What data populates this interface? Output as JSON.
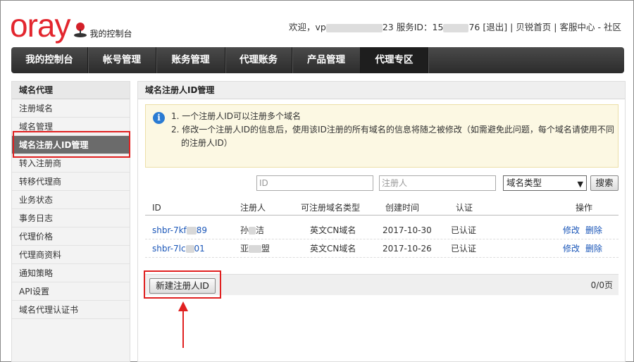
{
  "brand": {
    "logo": "oray",
    "console_label": "我的控制台"
  },
  "topbar": {
    "welcome": "欢迎，vp",
    "user_suffix": "23",
    "service_id_label": "服务ID：15",
    "service_id_suffix": "76",
    "logout": "[退出]",
    "sep1": "|",
    "home_link": "贝锐首页",
    "sep2": "|",
    "support_link": "客服中心",
    "dash": "-",
    "community_link": "社区"
  },
  "nav": {
    "items": [
      {
        "label": "我的控制台"
      },
      {
        "label": "帐号管理"
      },
      {
        "label": "账务管理"
      },
      {
        "label": "代理账务"
      },
      {
        "label": "产品管理"
      },
      {
        "label": "代理专区"
      }
    ],
    "active_index": 5
  },
  "sidebar": {
    "title": "域名代理",
    "items": [
      {
        "label": "注册域名"
      },
      {
        "label": "域名管理"
      },
      {
        "label": "域名注册人ID管理"
      },
      {
        "label": "转入注册商"
      },
      {
        "label": "转移代理商"
      },
      {
        "label": "业务状态"
      },
      {
        "label": "事务日志"
      },
      {
        "label": "代理价格"
      },
      {
        "label": "代理商资料"
      },
      {
        "label": "通知策略"
      },
      {
        "label": "API设置"
      },
      {
        "label": "域名代理认证书"
      }
    ],
    "active_index": 2
  },
  "main": {
    "title": "域名注册人ID管理",
    "notice": {
      "icon": "info-icon",
      "line1": "1. 一个注册人ID可以注册多个域名",
      "line2a": "2. 修改一个注册人ID的信息后，使用该ID注册的所有域名的信息将随之被修改（如需避免此问题，每个域名请使用不同",
      "line2b": "的注册人ID）"
    },
    "search": {
      "id_placeholder": "ID",
      "registrant_placeholder": "注册人",
      "domain_type_selected": "域名类型",
      "search_button": "搜索"
    },
    "table": {
      "headers": {
        "id": "ID",
        "registrant": "注册人",
        "types": "可注册域名类型",
        "created": "创建时间",
        "verified": "认证",
        "actions": "操作"
      },
      "rows": [
        {
          "id_prefix": "shbr-7kf",
          "id_suffix": "89",
          "name_prefix": "孙",
          "name_suffix": "洁",
          "type": "英文CN域名",
          "created": "2017-10-30",
          "verified": "已认证",
          "edit": "修改",
          "delete": "删除"
        },
        {
          "id_prefix": "shbr-7lc",
          "id_suffix": "01",
          "name_prefix": "亚",
          "name_suffix": "盟",
          "type": "英文CN域名",
          "created": "2017-10-26",
          "verified": "已认证",
          "edit": "修改",
          "delete": "删除"
        }
      ]
    },
    "new_button": "新建注册人ID",
    "pager": "0/0页"
  },
  "colors": {
    "brand_red": "#e3262e",
    "nav_bg": "#333333",
    "annotation_red": "#e02020",
    "link_blue": "#1a56b8"
  }
}
